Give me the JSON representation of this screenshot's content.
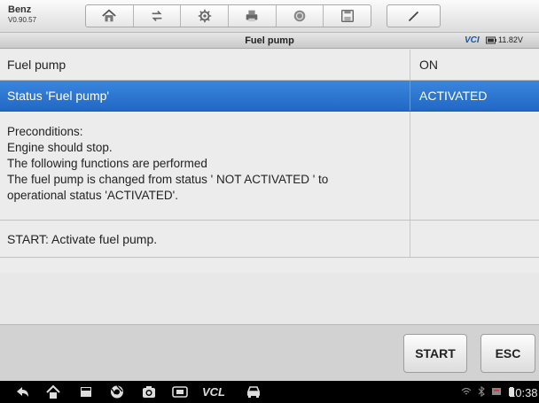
{
  "app": {
    "name": "Benz",
    "version": "V0.90.57"
  },
  "toolbar": {
    "buttons": [
      {
        "icon": "home-icon"
      },
      {
        "icon": "vehicle-swap-icon"
      },
      {
        "icon": "settings-icon"
      },
      {
        "icon": "print-icon"
      },
      {
        "icon": "help-icon"
      },
      {
        "icon": "save-icon"
      }
    ],
    "pen_icon": "pen-icon"
  },
  "titlebar": {
    "title": "Fuel pump",
    "vci_label": "VCI",
    "voltage": "11.82V"
  },
  "rows": [
    {
      "name": "Fuel pump",
      "value": "ON",
      "selected": false
    },
    {
      "name": "Status 'Fuel pump'",
      "value": "ACTIVATED",
      "selected": true
    }
  ],
  "preconditions": {
    "lines": [
      "Preconditions:",
      "Engine should stop.",
      "The following functions are performed",
      "The fuel pump is changed from status ' NOT ACTIVATED ' to",
      "operational status 'ACTIVATED'."
    ]
  },
  "start_row": {
    "text": "START: Activate fuel pump."
  },
  "actions": {
    "start_label": "START",
    "esc_label": "ESC"
  },
  "navbar": {
    "vcl_label": "VCL",
    "time": "10:38"
  },
  "colors": {
    "selected_row": "#2a74d0",
    "toolbar": "#e6e6e6",
    "navbar": "#000000"
  }
}
